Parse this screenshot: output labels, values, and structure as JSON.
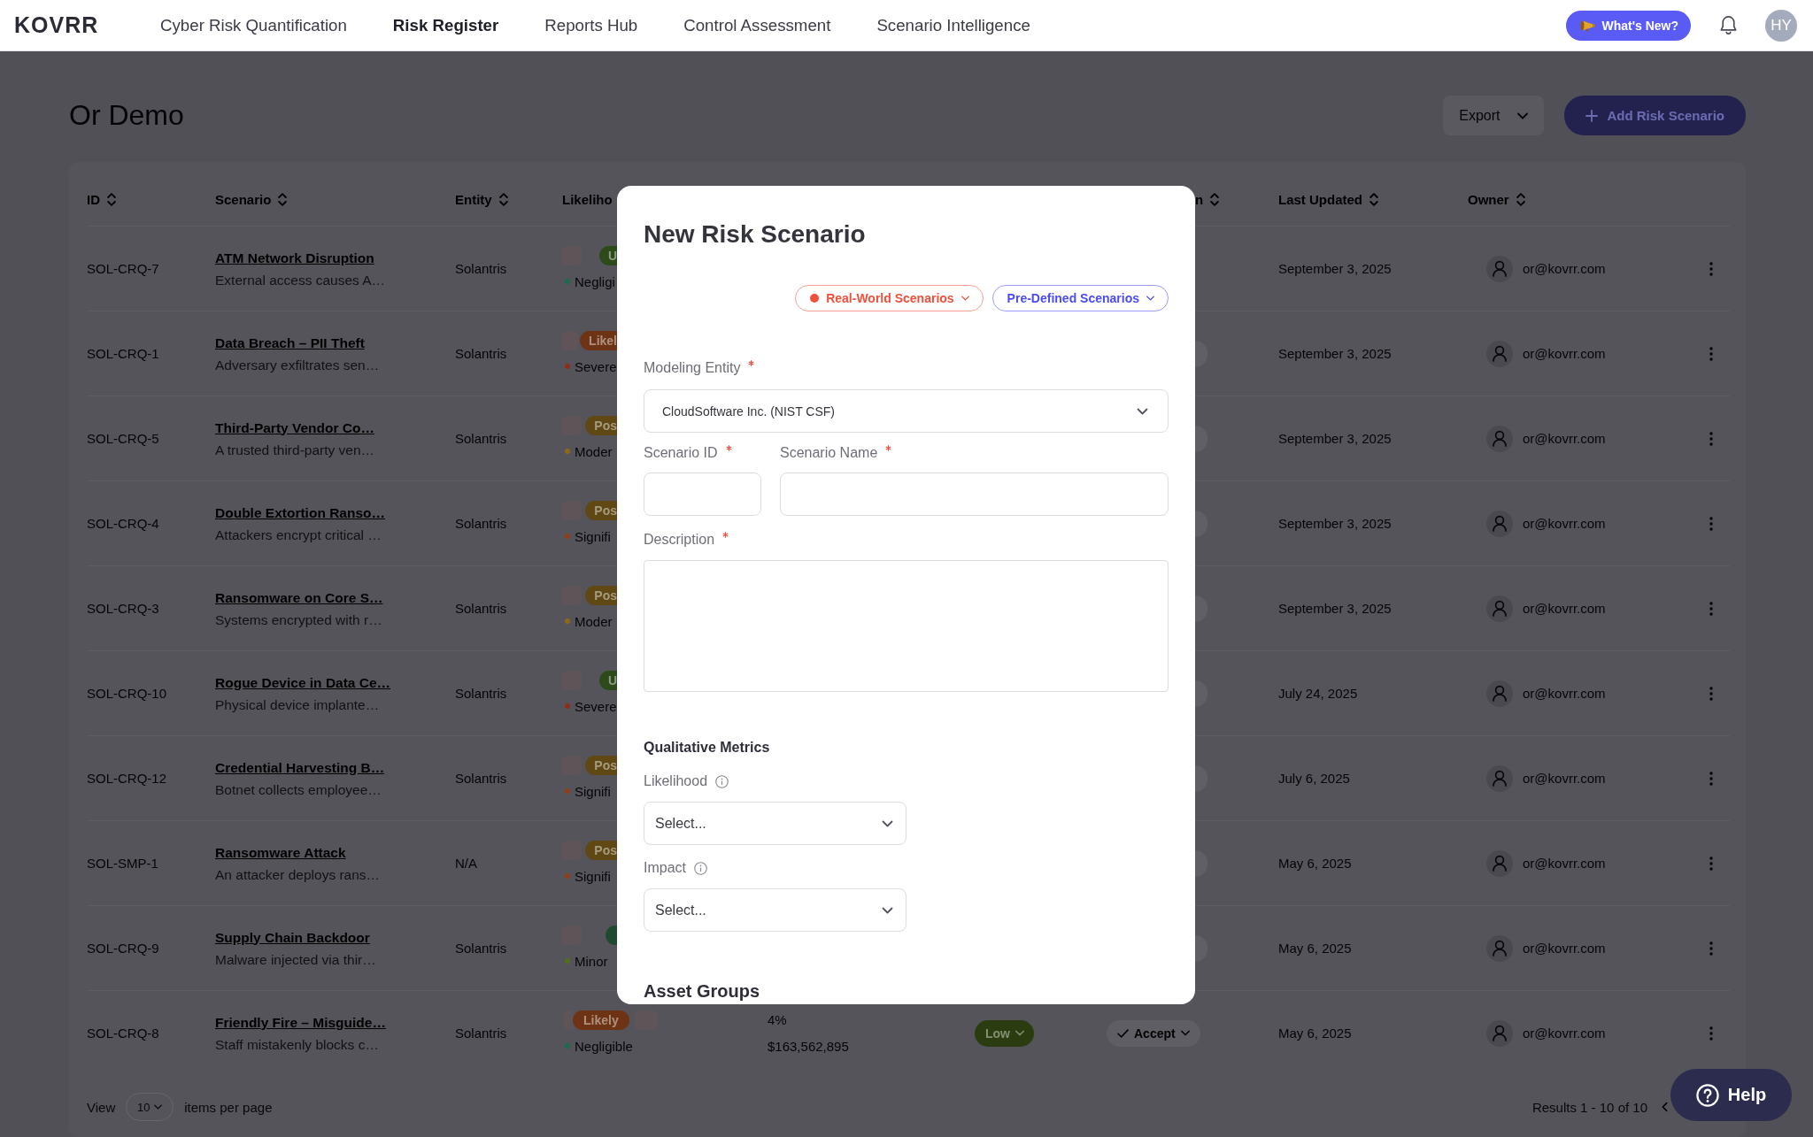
{
  "nav": {
    "logo": "KOVRR",
    "items": [
      {
        "label": "Cyber Risk Quantification",
        "selected": false
      },
      {
        "label": "Risk Register",
        "selected": true
      },
      {
        "label": "Reports Hub",
        "selected": false
      },
      {
        "label": "Control Assessment",
        "selected": false
      },
      {
        "label": "Scenario Intelligence",
        "selected": false
      }
    ],
    "whats_new": "What's New?",
    "avatar": "HY"
  },
  "page": {
    "title": "Or Demo",
    "export_button": "Export",
    "add_button": "Add Risk Scenario"
  },
  "table": {
    "columns": [
      {
        "label": "ID",
        "sortable": true
      },
      {
        "label": "Scenario",
        "sortable": true
      },
      {
        "label": "Entity",
        "sortable": true
      },
      {
        "label": "Likeliho"
      },
      {
        "label": "n",
        "sortable": true
      },
      {
        "label": "Last Updated",
        "sortable": true
      },
      {
        "label": "Owner",
        "sortable": true
      }
    ],
    "rows": [
      {
        "id": "SOL-CRQ-7",
        "title": "ATM Network Disruption",
        "description": "External access causes A…",
        "entity": "Solantris",
        "likelihood": {
          "label": "U",
          "color": "#2c4a1a"
        },
        "impact": {
          "label": "Negligi",
          "color": "#1d6a4c"
        },
        "last_updated": "September 3, 2025",
        "owner": "or@kovrr.com"
      },
      {
        "id": "SOL-CRQ-1",
        "title": "Data Breach – PII Theft",
        "description": "Adversary exfiltrates sen…",
        "entity": "Solantris",
        "likelihood": {
          "label": "Likel",
          "color": "#6e3315"
        },
        "impact": {
          "label": "Severe",
          "color": "#8c2f1a"
        },
        "response": {
          "covered": true
        },
        "last_updated": "September 3, 2025",
        "owner": "or@kovrr.com"
      },
      {
        "id": "SOL-CRQ-5",
        "title": "Third-Party Vendor Co…",
        "description": "A trusted third-party ven…",
        "entity": "Solantris",
        "likelihood": {
          "label": "Pos",
          "color": "#5f4813"
        },
        "impact": {
          "label": "Moder",
          "color": "#8d6a12"
        },
        "response": {
          "covered": true
        },
        "last_updated": "September 3, 2025",
        "owner": "or@kovrr.com"
      },
      {
        "id": "SOL-CRQ-4",
        "title": "Double Extortion Ranso…",
        "description": "Attackers encrypt critical …",
        "entity": "Solantris",
        "likelihood": {
          "label": "Pos",
          "color": "#5f4813"
        },
        "impact": {
          "label": "Signifi",
          "color": "#8f3d1a"
        },
        "response": {
          "covered": true
        },
        "last_updated": "September 3, 2025",
        "owner": "or@kovrr.com"
      },
      {
        "id": "SOL-CRQ-3",
        "title": "Ransomware on Core S…",
        "description": "Systems encrypted with r…",
        "entity": "Solantris",
        "likelihood": {
          "label": "Pos",
          "color": "#5f4813"
        },
        "impact": {
          "label": "Moder",
          "color": "#8d6a12"
        },
        "response": {
          "covered": true
        },
        "last_updated": "September 3, 2025",
        "owner": "or@kovrr.com"
      },
      {
        "id": "SOL-CRQ-10",
        "title": "Rogue Device in Data Ce…",
        "description": "Physical device implante…",
        "entity": "Solantris",
        "likelihood": {
          "label": "U",
          "color": "#2c4a1a"
        },
        "impact": {
          "label": "Severe",
          "color": "#8c2f1a"
        },
        "response": {
          "covered": true
        },
        "last_updated": "July 24, 2025",
        "owner": "or@kovrr.com"
      },
      {
        "id": "SOL-CRQ-12",
        "title": "Credential Harvesting B…",
        "description": "Botnet collects employee…",
        "entity": "Solantris",
        "likelihood": {
          "label": "Pos",
          "color": "#5f4813"
        },
        "impact": {
          "label": "Signifi",
          "color": "#8f3d1a"
        },
        "response": {
          "covered": true
        },
        "last_updated": "July 6, 2025",
        "owner": "or@kovrr.com"
      },
      {
        "id": "SOL-SMP-1",
        "title": "Ransomware Attack",
        "description": "An attacker deploys rans…",
        "entity": "N/A",
        "likelihood": {
          "label": "Pos",
          "color": "#5f4813"
        },
        "impact": {
          "label": "Signifi",
          "color": "#8f3d1a"
        },
        "response": {
          "covered": true
        },
        "last_updated": "May 6, 2025",
        "owner": "or@kovrr.com"
      },
      {
        "id": "SOL-CRQ-9",
        "title": "Supply Chain Backdoor",
        "description": "Malware injected via thir…",
        "entity": "Solantris",
        "likelihood": {
          "color": "#1f4a30"
        },
        "impact": {
          "label": "Minor",
          "color": "#51701c"
        },
        "response": {
          "covered": true
        },
        "last_updated": "May 6, 2025",
        "owner": "or@kovrr.com"
      },
      {
        "id": "SOL-CRQ-8",
        "title": "Friendly Fire – Misguide…",
        "description": "Staff mistakenly blocks c…",
        "entity": "Solantris",
        "likelihood": {
          "label": "Likely",
          "color": "#6e3315"
        },
        "impact": {
          "label": "Negligible",
          "color": "#1d6a4c"
        },
        "probability": "4%",
        "loss": "$163,562,895",
        "rating": {
          "label": "Low",
          "color": "#2b3d10"
        },
        "response": {
          "label": "Accept",
          "covered": false
        },
        "last_updated": "May 6, 2025",
        "owner": "or@kovrr.com"
      }
    ]
  },
  "pagination": {
    "view_label": "View",
    "page_size": "10",
    "per_page_label": "items per page",
    "results": "Results 1 - 10 of 10"
  },
  "help_button": "Help",
  "modal": {
    "title": "New Risk Scenario",
    "source_buttons": [
      {
        "label": "Real-World Scenarios",
        "kind": "real-world",
        "color": "#f0503c"
      },
      {
        "label": "Pre-Defined Scenarios",
        "kind": "pre-defined",
        "color": "#4b4cf2"
      }
    ],
    "modeling_entity": {
      "label": "Modeling Entity",
      "required": true,
      "value": "CloudSoftware Inc. (NIST CSF)"
    },
    "scenario_id": {
      "label": "Scenario ID",
      "required": true
    },
    "scenario_name": {
      "label": "Scenario Name",
      "required": true
    },
    "description": {
      "label": "Description",
      "required": true
    },
    "qualitative_metrics": {
      "heading": "Qualitative Metrics",
      "fields": [
        {
          "label": "Likelihood",
          "placeholder": "Select..."
        },
        {
          "label": "Impact",
          "placeholder": "Select..."
        }
      ]
    },
    "asset_groups": {
      "heading": "Asset Groups"
    }
  }
}
